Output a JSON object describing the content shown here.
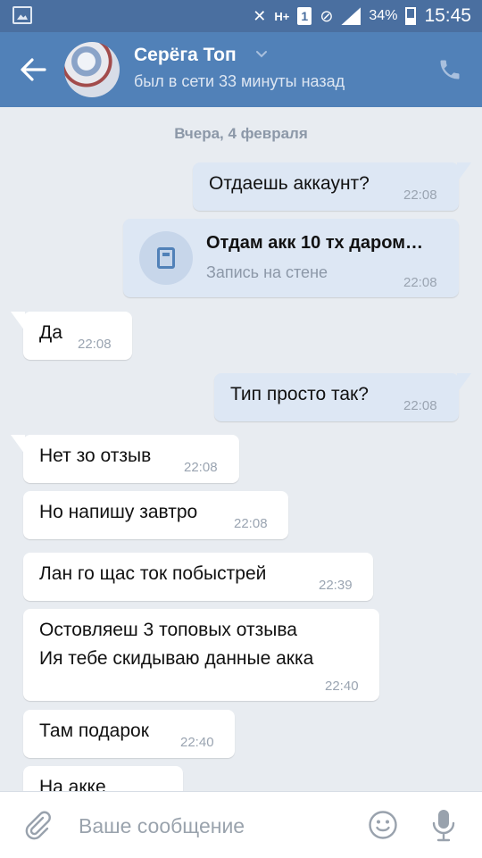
{
  "status_bar": {
    "battery": "34%",
    "time": "15:45",
    "network": "H+",
    "sim": "1"
  },
  "header": {
    "name": "Серёга Топ",
    "status": "был в сети 33 минуты назад"
  },
  "chat": {
    "date_separator": "Вчера, 4 февраля",
    "messages": [
      {
        "text": "Отдаешь аккаунт?",
        "time": "22:08"
      },
      {
        "title": "Отдам акк 10 тх даром…",
        "subtitle": "Запись на стене",
        "time": "22:08"
      },
      {
        "text": "Да",
        "time": "22:08"
      },
      {
        "text": "Тип просто так?",
        "time": "22:08"
      },
      {
        "text": "Нет зо отзыв",
        "time": "22:08"
      },
      {
        "text": "Но напишу завтро",
        "time": "22:08"
      },
      {
        "text": "Лан го щас ток побыстрей",
        "time": "22:39"
      },
      {
        "line1": "Остовляеш 3 топовых отзыва",
        "line2": "Ия тебе скидываю данные акка",
        "time": "22:40"
      },
      {
        "text": "Там подарок",
        "time": "22:40"
      },
      {
        "text": "На акке"
      }
    ]
  },
  "composer": {
    "placeholder": "Ваше сообщение"
  },
  "colors": {
    "accent": "#5181b8",
    "outgoing_bubble": "#dde7f4",
    "background": "#e8ecf1"
  },
  "icons": [
    "gallery-icon",
    "mute-icon",
    "signal-icon",
    "battery-icon",
    "back-arrow-icon",
    "chevron-down-icon",
    "phone-icon",
    "wall-post-icon",
    "attach-icon",
    "emoji-icon",
    "microphone-icon"
  ]
}
